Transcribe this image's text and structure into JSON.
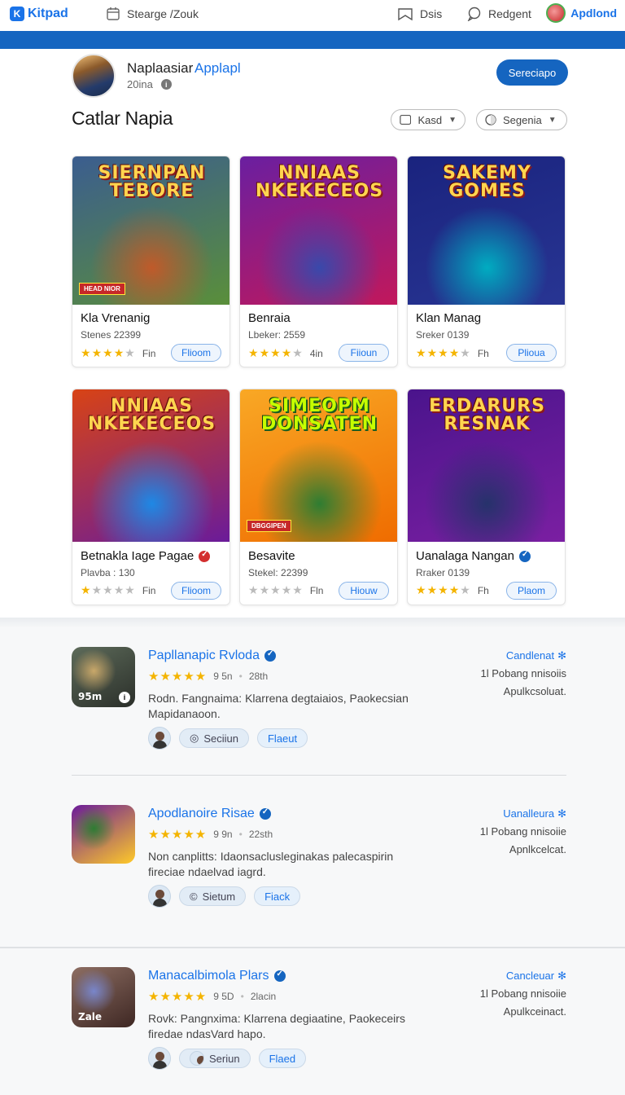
{
  "topbar": {
    "brand": "Kitpad",
    "nav": [
      {
        "label": "Stearge /Zouk",
        "icon": "calendar-icon"
      },
      {
        "label": "Dsis",
        "icon": "bookmark-icon"
      },
      {
        "label": "Redgent",
        "icon": "chat-icon"
      }
    ],
    "user_label": "Apdlond"
  },
  "profile": {
    "name": "Naplaasiar",
    "link": "Applapl",
    "sub": "20ina",
    "button": "Sereciapo"
  },
  "section": {
    "title": "Catlar Napia",
    "filters": [
      {
        "label": "Kasd",
        "icon": "square-icon"
      },
      {
        "label": "Segenia",
        "icon": "toggle-icon"
      }
    ]
  },
  "cards": [
    {
      "art_title": "SIERNPAN TEBORE",
      "tag": "HEAD NIOR",
      "title": "Kla Vrenanig",
      "sub": "Stenes 22399",
      "rating": 3.5,
      "rating_text": "Fin",
      "button": "Flioom",
      "badge": "",
      "colors": [
        "#3b5d8f",
        "#5a8f3a",
        "#c05a2a"
      ]
    },
    {
      "art_title": "NNIAAS NKEKECEOS",
      "tag": "",
      "title": "Benraia",
      "sub": "Lbeker: 2559",
      "rating": 4,
      "rating_text": "4in",
      "button": "Fiioun",
      "badge": "",
      "colors": [
        "#6a1fa0",
        "#c2185b",
        "#3949ab"
      ]
    },
    {
      "art_title": "SAKEMY GOMES",
      "tag": "",
      "title": "Klan Manag",
      "sub": "Sreker 0139",
      "rating": 4,
      "rating_text": "Fh",
      "button": "Plioua",
      "badge": "",
      "colors": [
        "#1a237e",
        "#283593",
        "#00acc1"
      ]
    },
    {
      "art_title": "NNIAAS NKEKECEOS",
      "tag": "",
      "title": "Betnakla Iage Pagae",
      "sub": "Plavba : 130",
      "rating": 1,
      "rating_text": "Fin",
      "button": "Flioom",
      "badge": "red",
      "colors": [
        "#d84315",
        "#6a1b9a",
        "#1e88e5"
      ]
    },
    {
      "art_title": "SIMEOPM DONSATEN",
      "tag": "DBGGIPEN",
      "title": "Besavite",
      "sub": "Stekel: 22399",
      "rating": 0,
      "rating_text": "Fln",
      "button": "Hiouw",
      "badge": "",
      "colors": [
        "#f9a825",
        "#ef6c00",
        "#2e7d32"
      ]
    },
    {
      "art_title": "ERDARURS RESNAK",
      "tag": "",
      "title": "Uanalaga Nangan",
      "sub": "Rraker 0139",
      "rating": 3.5,
      "rating_text": "Fh",
      "button": "Plaom",
      "badge": "blue",
      "colors": [
        "#4a148c",
        "#7b1fa2",
        "#26326b"
      ]
    }
  ],
  "list": [
    {
      "title": "Papllanapic Rvloda",
      "rating_value": "9 5n",
      "count": "28th",
      "desc": "Rodn. Fangnaima: Klarrena degtaiaios, Paokecsian Mapidanaoon.",
      "side_1": "Candlenat",
      "side_2": "1l Pobang nnisoiis",
      "side_3": "Apulkcsoluat.",
      "icon_label": "95m",
      "pill_1": "Seciiun",
      "pill_2": "Flaeut",
      "colors": [
        "#5d6b5a",
        "#2b2f2a",
        "#c9a86a"
      ]
    },
    {
      "title": "Apodlanoire Risae",
      "rating_value": "9 9n",
      "count": "22sth",
      "desc": "Non canplitts: Idaonsaclusleginakas palecaspirin fireciae ndaelvad iagrd.",
      "side_1": "Uanalleura",
      "side_2": "1l Pobang nnisoiie",
      "side_3": "Apnlkcelcat.",
      "icon_label": "",
      "pill_1": "Sietum",
      "pill_2": "Fiack",
      "colors": [
        "#6a1b9a",
        "#ffca28",
        "#2e7d32"
      ]
    },
    {
      "title": "Manacalbimola Plars",
      "rating_value": "9 5D",
      "count": "2lacin",
      "desc": "Rovk: Pangnxima: Klarrena degiaatine, Paokeceirs firedae ndasVard hapo.",
      "side_1": "Cancleuar",
      "side_2": "1l Pobang nnisoiie",
      "side_3": "Apulkceinact.",
      "icon_label": "Zale",
      "pill_1": "Seriun",
      "pill_2": "Flaed",
      "colors": [
        "#8d6e63",
        "#3e2723",
        "#7986cb"
      ]
    }
  ]
}
